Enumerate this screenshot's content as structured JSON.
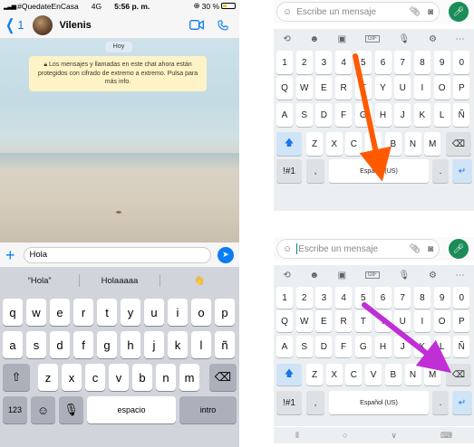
{
  "left_phone": {
    "status": {
      "carrier": "#QuedateEnCasa",
      "network": "4G",
      "time": "5:56 p. m.",
      "battery": "30 %",
      "battery_level": 0.3
    },
    "header": {
      "back_count": "1",
      "contact_name": "Vilenis"
    },
    "chat": {
      "date_badge": "Hoy",
      "encryption_notice": "Los mensajes y llamadas en este chat ahora están protegidos con cifrado de extremo a extremo. Pulsa para más info."
    },
    "composer": {
      "value": "Hola"
    },
    "suggestions": [
      "“Hola”",
      "Holaaaaa",
      "👋"
    ],
    "keyboard": {
      "row1": [
        "q",
        "w",
        "e",
        "r",
        "t",
        "y",
        "u",
        "i",
        "o",
        "p"
      ],
      "row2": [
        "a",
        "s",
        "d",
        "f",
        "g",
        "h",
        "j",
        "k",
        "l",
        "ñ"
      ],
      "row3": [
        "z",
        "x",
        "c",
        "v",
        "b",
        "n",
        "m"
      ],
      "numbers_key": "123",
      "space_key": "espacio",
      "return_key": "intro"
    }
  },
  "android_panels": [
    {
      "input_placeholder": "Escribe un mensaje",
      "numbers": [
        "1",
        "2",
        "3",
        "4",
        "5",
        "6",
        "7",
        "8",
        "9",
        "0"
      ],
      "row1": [
        "Q",
        "W",
        "E",
        "R",
        "T",
        "Y",
        "U",
        "I",
        "O",
        "P"
      ],
      "row2": [
        "A",
        "S",
        "D",
        "F",
        "G",
        "H",
        "J",
        "K",
        "L",
        "Ñ"
      ],
      "row3": [
        "Z",
        "X",
        "C",
        "V",
        "B",
        "N",
        "M"
      ],
      "symbols_key": "!#1",
      "comma_key": ",",
      "space_key": "Español (US)",
      "period_key": ".",
      "gif_label": "GIF",
      "arrow_color": "#ff5a00"
    },
    {
      "input_placeholder": "Escribe un mensaje",
      "numbers": [
        "1",
        "2",
        "3",
        "4",
        "5",
        "6",
        "7",
        "8",
        "9",
        "0"
      ],
      "row1": [
        "Q",
        "W",
        "E",
        "R",
        "T",
        "Y",
        "U",
        "I",
        "O",
        "P"
      ],
      "row2": [
        "A",
        "S",
        "D",
        "F",
        "G",
        "H",
        "J",
        "K",
        "L",
        "Ñ"
      ],
      "row3": [
        "Z",
        "X",
        "C",
        "V",
        "B",
        "N",
        "M"
      ],
      "symbols_key": "!#1",
      "comma_key": ",",
      "space_key": "Español (US)",
      "period_key": ".",
      "gif_label": "GIF",
      "arrow_color": "#c02fd6"
    }
  ]
}
